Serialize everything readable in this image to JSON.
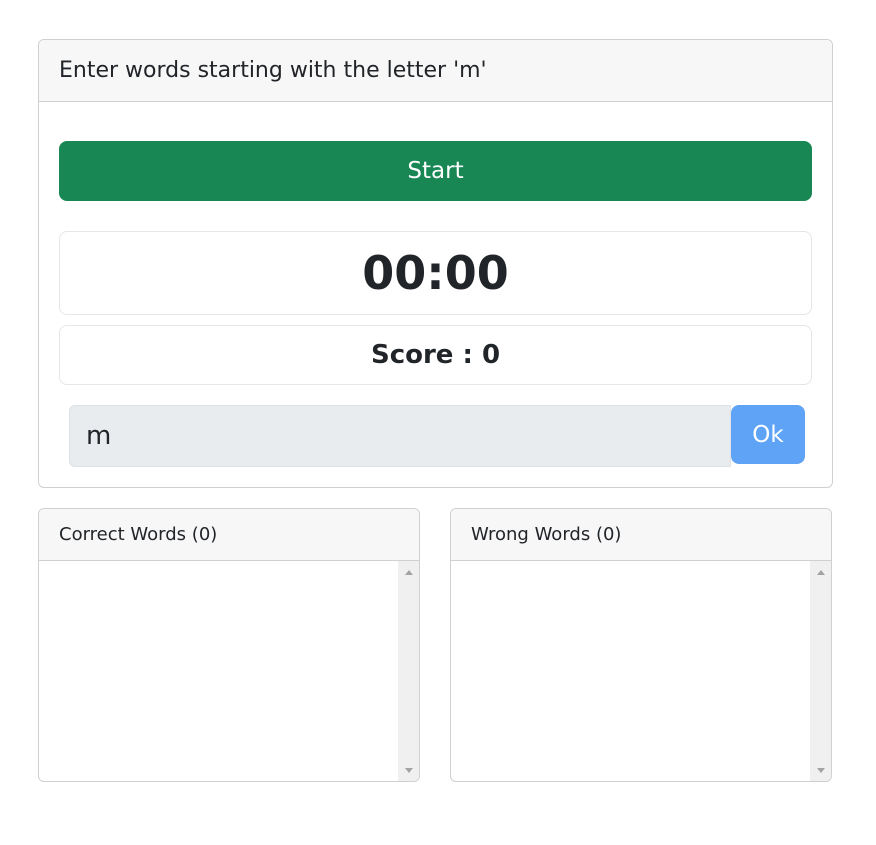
{
  "main_card": {
    "title": "Enter words starting with the letter 'm'",
    "start_label": "Start",
    "timer": "00:00",
    "score_label": "Score : ",
    "score_value": "0",
    "input_value": "m",
    "ok_label": "Ok"
  },
  "correct_words": {
    "title": "Correct Words ",
    "count": "(0)",
    "items": []
  },
  "wrong_words": {
    "title": "Wrong Words ",
    "count": "(0)",
    "items": []
  },
  "colors": {
    "start_button": "#198754",
    "ok_button": "#5fa3f7",
    "input_background": "#e9ecef",
    "card_header": "#f7f7f7"
  },
  "icons": {
    "scroll_up": "triangle-up-icon",
    "scroll_down": "triangle-down-icon"
  }
}
